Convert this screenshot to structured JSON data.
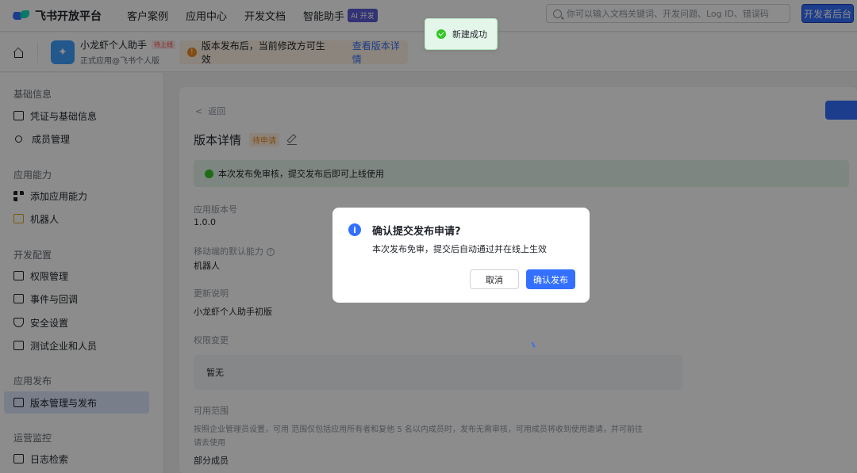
{
  "topbar": {
    "logo_text": "飞书开放平台",
    "nav": [
      "客户案例",
      "应用中心",
      "开发文档",
      "智能助手"
    ],
    "ai_badge": "AI 开发",
    "search_placeholder": "你可以输入文档关键词、开发问题、Log ID、错误码",
    "dev_button": "开发者后台"
  },
  "appbar": {
    "app_name": "小龙虾个人助手",
    "app_tag": "待上线",
    "app_sub": "正式应用@飞书个人版",
    "notice_text": "版本发布后，当前修改方可生效",
    "notice_link": "查看版本详情"
  },
  "sidebar": {
    "sections": [
      {
        "title": "基础信息",
        "items": [
          "凭证与基础信息",
          "成员管理"
        ]
      },
      {
        "title": "应用能力",
        "items": [
          "添加应用能力",
          "机器人"
        ]
      },
      {
        "title": "开发配置",
        "items": [
          "权限管理",
          "事件与回调",
          "安全设置",
          "测试企业和人员"
        ]
      },
      {
        "title": "应用发布",
        "items": [
          "版本管理与发布"
        ]
      },
      {
        "title": "运营监控",
        "items": [
          "日志检索"
        ]
      }
    ],
    "active": "版本管理与发布"
  },
  "main": {
    "back": "返回",
    "title": "版本详情",
    "status_tag": "待申请",
    "success_text": "本次发布免审核，提交发布后即可上线使用",
    "version_label": "应用版本号",
    "version_value": "1.0.0",
    "mobile_label": "移动端的默认能力",
    "mobile_value": "机器人",
    "update_label": "更新说明",
    "update_value": "小龙虾个人助手初版",
    "perm_label": "权限变更",
    "perm_value": "暂无",
    "scope_label": "可用范围",
    "scope_desc": "按照企业管理员设置，可用 范围仅包括应用所有者和复他 5 名以内成员时，发布无需审核，可用成员将收到使用邀请，并可前往",
    "scope_desc2": "请去使用",
    "scope_value": "部分成员"
  },
  "dialog": {
    "title": "确认提交发布申请?",
    "text": "本次发布免审，提交后自动通过并在线上生效",
    "cancel": "取消",
    "confirm": "确认发布"
  },
  "toast": {
    "text": "新建成功"
  }
}
